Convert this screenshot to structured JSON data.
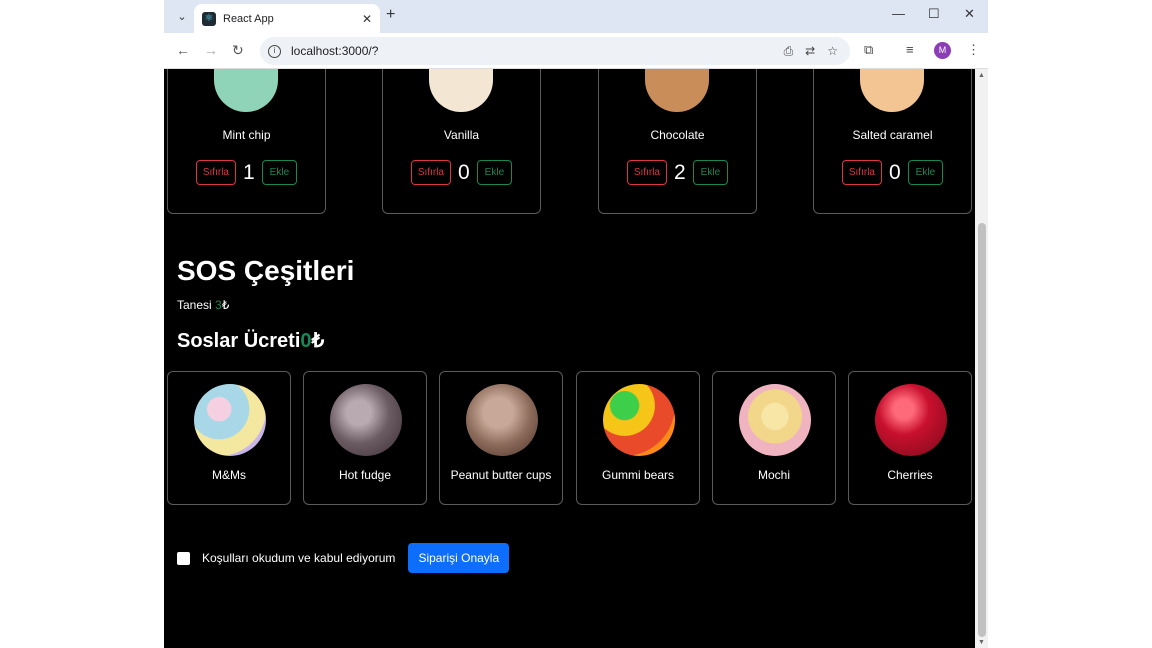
{
  "browser": {
    "tab_title": "React App",
    "url": "localhost:3000/?",
    "avatar_letter": "M"
  },
  "flavors": [
    {
      "name": "Mint chip",
      "count": "1",
      "color": "#8fd3b8"
    },
    {
      "name": "Vanilla",
      "count": "0",
      "color": "#f3e6d2"
    },
    {
      "name": "Chocolate",
      "count": "2",
      "color": "#c98d5a"
    },
    {
      "name": "Salted caramel",
      "count": "0",
      "color": "#f2c592"
    }
  ],
  "flavor_buttons": {
    "reset_label": "Sıfırla",
    "add_label": "Ekle"
  },
  "sauces": {
    "title": "SOS Çeşitleri",
    "unit_price_label": "Tanesi ",
    "unit_price_value": "3",
    "currency": "₺",
    "total_label": "Soslar Ücreti",
    "total_value": "0",
    "items": [
      {
        "name": "M&Ms",
        "color": "#a8d8e8"
      },
      {
        "name": "Hot fudge",
        "color": "#6b5b63"
      },
      {
        "name": "Peanut butter cups",
        "color": "#8b6a5a"
      },
      {
        "name": "Gummi bears",
        "color": "#e84a2a"
      },
      {
        "name": "Mochi",
        "color": "#f2d68a"
      },
      {
        "name": "Cherries",
        "color": "#c8102e"
      }
    ]
  },
  "order": {
    "terms_label": "Koşulları okudum ve kabul ediyorum",
    "confirm_label": "Siparişi Onayla"
  }
}
